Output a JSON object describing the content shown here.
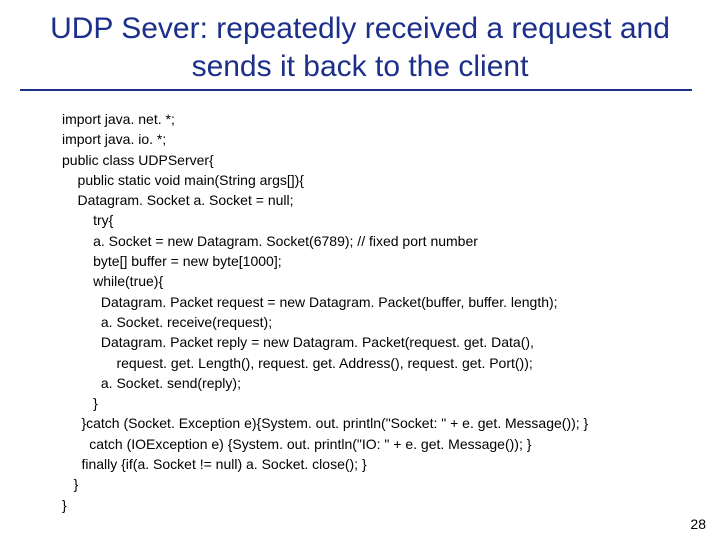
{
  "title": "UDP Sever: repeatedly received a request and sends it back to the client",
  "code": {
    "lines": [
      "import java. net. *;",
      "import java. io. *;",
      "public class UDPServer{",
      "    public static void main(String args[]){",
      "    Datagram. Socket a. Socket = null;",
      "        try{",
      "        a. Socket = new Datagram. Socket(6789); // fixed port number",
      "        byte[] buffer = new byte[1000];",
      "        while(true){",
      "          Datagram. Packet request = new Datagram. Packet(buffer, buffer. length);",
      "          a. Socket. receive(request);",
      "          Datagram. Packet reply = new Datagram. Packet(request. get. Data(),",
      "              request. get. Length(), request. get. Address(), request. get. Port());",
      "          a. Socket. send(reply);",
      "        }",
      "     }catch (Socket. Exception e){System. out. println(\"Socket: \" + e. get. Message()); }",
      "       catch (IOException e) {System. out. println(\"IO: \" + e. get. Message()); }",
      "     finally {if(a. Socket != null) a. Socket. close(); }",
      "   }",
      "}"
    ]
  },
  "page_number": "28"
}
